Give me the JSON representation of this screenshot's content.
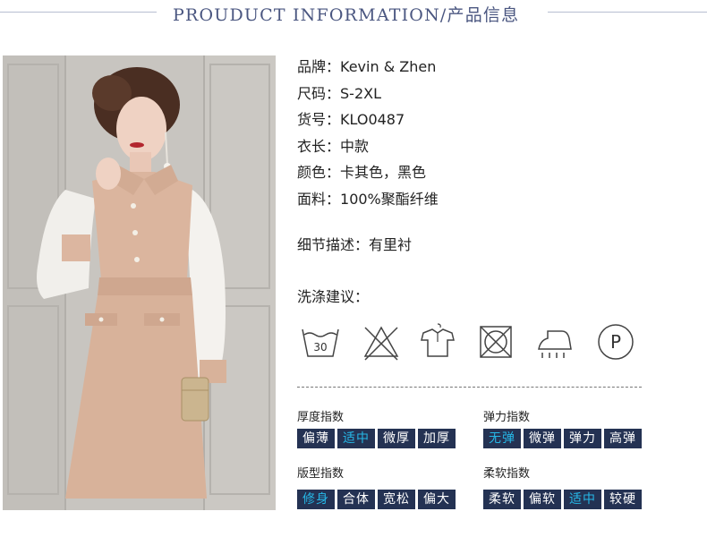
{
  "header": {
    "title": "PROUDUCT INFORMATION/产品信息"
  },
  "specs": [
    {
      "label": "品牌：",
      "value": "Kevin & Zhen"
    },
    {
      "label": "尺码：",
      "value": "S-2XL"
    },
    {
      "label": "货号：",
      "value": "KLO0487"
    },
    {
      "label": "衣长：",
      "value": "中款"
    },
    {
      "label": "颜色：",
      "value": "卡其色，黑色"
    },
    {
      "label": "面料：",
      "value": "100%聚酯纤维"
    }
  ],
  "detail": {
    "label": "细节描述：",
    "value": "有里衬"
  },
  "wash": {
    "title": "洗涤建议：",
    "icons": [
      "wash-30-icon",
      "do-not-bleach-icon",
      "hang-dry-icon",
      "do-not-tumble-dry-icon",
      "iron-steam-icon",
      "dry-clean-p-icon"
    ],
    "wash_temp": "30",
    "dryclean_letter": "P"
  },
  "indices": {
    "thickness": {
      "title": "厚度指数",
      "options": [
        "偏薄",
        "适中",
        "微厚",
        "加厚"
      ],
      "selected": "适中"
    },
    "elasticity": {
      "title": "弹力指数",
      "options": [
        "无弹",
        "微弹",
        "弹力",
        "高弹"
      ],
      "selected": "无弹"
    },
    "fit": {
      "title": "版型指数",
      "options": [
        "修身",
        "合体",
        "宽松",
        "偏大"
      ],
      "selected": "修身"
    },
    "softness": {
      "title": "柔软指数",
      "options": [
        "柔软",
        "偏软",
        "适中",
        "较硬"
      ],
      "selected": "适中"
    }
  },
  "colors": {
    "header_text": "#4a5680",
    "option_bg": "#243253",
    "option_selected_text": "#26b7e6",
    "dress": "#d8b29a"
  }
}
